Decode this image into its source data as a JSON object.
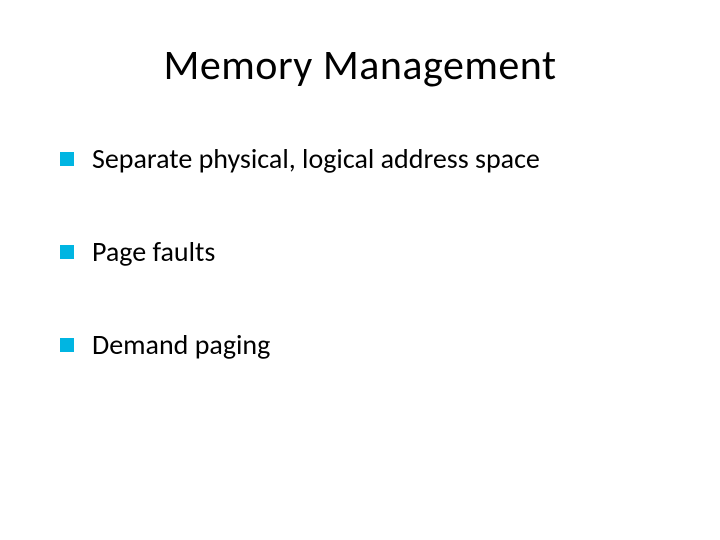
{
  "slide": {
    "title": "Memory Management",
    "bullets": [
      {
        "text": "Separate physical, logical address space"
      },
      {
        "text": "Page faults"
      },
      {
        "text": "Demand paging"
      }
    ]
  },
  "colors": {
    "bullet": "#00b5e2",
    "text": "#000000",
    "background": "#ffffff"
  }
}
